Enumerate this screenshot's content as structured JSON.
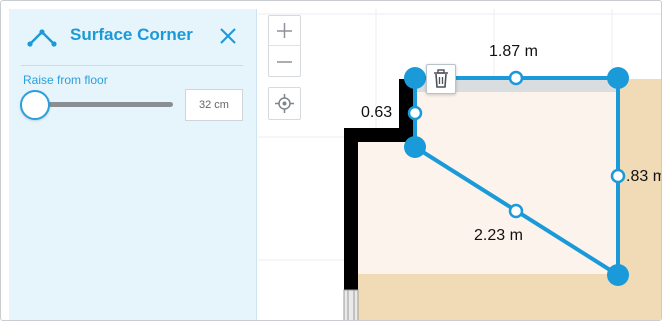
{
  "panel": {
    "title": "Surface Corner",
    "title_icon": "surface-corner-icon",
    "close_icon": "close-icon",
    "raise_label": "Raise from floor",
    "raise_value": "32 cm",
    "slider_level": 0
  },
  "map_controls": {
    "zoom_in_icon": "plus-icon",
    "zoom_out_icon": "minus-icon",
    "locate_icon": "crosshair-icon",
    "delete_icon": "trash-icon"
  },
  "dimensions": {
    "top": "1.87 m",
    "left": "0.63",
    "right": ".83 m",
    "diagonal": "2.23 m"
  },
  "colors": {
    "accent": "#1a9ad9",
    "panel_bg": "#e6f4fb",
    "floor": "#f1dbb6",
    "room_fill": "#fcf3ec",
    "wall": "#000000"
  }
}
